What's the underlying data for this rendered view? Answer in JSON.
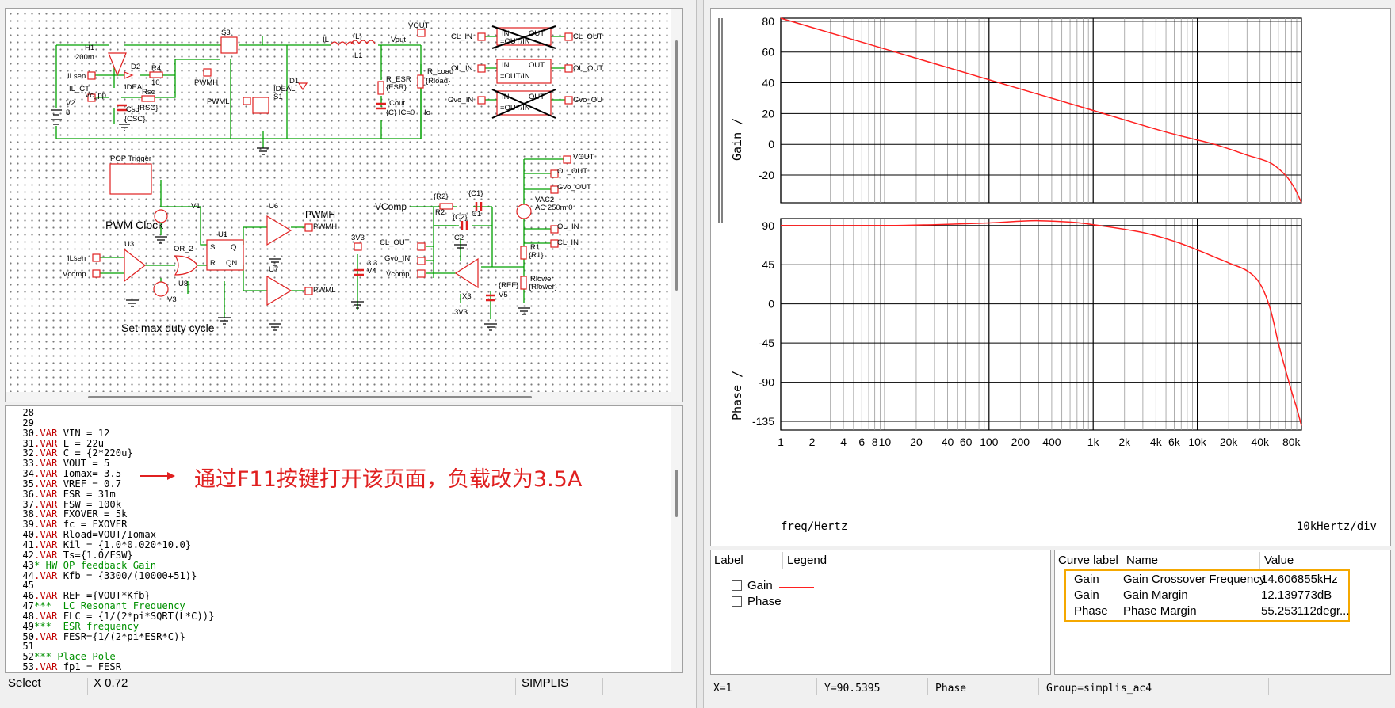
{
  "schematic": {
    "labels": {
      "vout_top": "VOUT",
      "il": "IL",
      "l_val": "{L}",
      "l1": "L1",
      "vout_probe": "Vout",
      "h1": "H1",
      "h1_val": "200m",
      "d2": "D2",
      "d2_val": "IDEAL",
      "r4": "R4",
      "r4_val": "10",
      "ilsen1": "ILsen",
      "il_ct": "IL_CT",
      "vc_pp": "Vc_pp",
      "rsc": "Rsc",
      "rsc_val": "{RSC}",
      "csc": "Csc",
      "csc_val": "{CSC}",
      "v2": "V2",
      "v2_val": "8",
      "s3": "S3",
      "pwmh1": "PWMH",
      "pwml1": "PWML",
      "s1": "S1",
      "d1": "D1",
      "d1_val": "IDEAL",
      "r_esr": "R_ESR",
      "r_esr_val": "{ESR}",
      "cout": "Cout",
      "cout_val": "{C} IC=0",
      "io": "Io",
      "r_load": "R_Load",
      "r_load_val": "{Rload}",
      "cl_in": "CL_IN",
      "cl_out": "CL_OUT",
      "ol_in": "OL_IN",
      "ol_out": "OL_OUT",
      "gvo_in": "Gvo_IN",
      "gvo_out": "Gvo_OU",
      "blk_in": "IN",
      "blk_out": "OUT",
      "blk_eq": "=OUT/IN",
      "pop": "POP Trigger",
      "v1": "V1",
      "pwm_clock": "PWM Clock",
      "u3": "U3",
      "ilsen2": "ILsen",
      "vcomp1": "Vcomp",
      "or2": "OR_2",
      "u8": "U8",
      "v3": "V3",
      "u1": "U1",
      "pin_s": "S",
      "pin_q": "Q",
      "pin_r": "R",
      "pin_qn": "QN",
      "u6": "U6",
      "u7": "U7",
      "pwmh2": "PWMH",
      "pwmh3": "PWMH",
      "pwml2": "PWML",
      "max_duty": "Set max duty cycle",
      "v3v3a": "3V3",
      "v4_val": "3.3",
      "v4": "V4",
      "vcomp2": "VComp",
      "r2_val": "{R2}",
      "r2": "R2",
      "c1_val": "{C1}",
      "c1": "C1",
      "c2_val": "{C2}",
      "c2": "C2",
      "cl_out2": "CL_OUT",
      "gvo_in2": "Gvo_IN",
      "vcomp3": "Vcomp",
      "x3": "X3",
      "v3v3b": "3V3",
      "ref_val": "{REF}",
      "v5": "V5",
      "vout2": "VOUT",
      "ol_out2": "OL_OUT",
      "gvo_out2": "Gvo_OUT",
      "vac2": "VAC2",
      "vac2_val": "AC 250m 0",
      "ol_in2": "OL_IN",
      "cl_in2": "CL_IN",
      "r1": "R1",
      "r1_val": "{R1}",
      "rlower": "Rlower",
      "rlower_val": "{Rlower}"
    }
  },
  "editor": {
    "annotation": "通过F11按键打开该页面，负载改为3.5A",
    "lines": [
      {
        "n": "28",
        "kw": "",
        "text": "",
        "comment": ""
      },
      {
        "n": "29",
        "kw": "",
        "text": "",
        "comment": ""
      },
      {
        "n": "30",
        "kw": ".VAR",
        "text": " VIN = 12",
        "comment": ""
      },
      {
        "n": "31",
        "kw": ".VAR",
        "text": " L = 22u",
        "comment": ""
      },
      {
        "n": "32",
        "kw": ".VAR",
        "text": " C = {2*220u}",
        "comment": ""
      },
      {
        "n": "33",
        "kw": ".VAR",
        "text": " VOUT = 5",
        "comment": ""
      },
      {
        "n": "34",
        "kw": ".VAR",
        "text": " Iomax= 3.5",
        "comment": ""
      },
      {
        "n": "35",
        "kw": ".VAR",
        "text": " VREF = 0.7",
        "comment": ""
      },
      {
        "n": "36",
        "kw": ".VAR",
        "text": " ESR = 31m",
        "comment": ""
      },
      {
        "n": "37",
        "kw": ".VAR",
        "text": " FSW = 100k",
        "comment": ""
      },
      {
        "n": "38",
        "kw": ".VAR",
        "text": " FXOVER = 5k",
        "comment": ""
      },
      {
        "n": "39",
        "kw": ".VAR",
        "text": " fc = FXOVER",
        "comment": ""
      },
      {
        "n": "40",
        "kw": ".VAR",
        "text": " Rload=VOUT/Iomax",
        "comment": ""
      },
      {
        "n": "41",
        "kw": ".VAR",
        "text": " Kil = {1.0*0.020*10.0}",
        "comment": ""
      },
      {
        "n": "42",
        "kw": ".VAR",
        "text": " Ts={1.0/FSW}",
        "comment": ""
      },
      {
        "n": "43",
        "kw": "",
        "text": "",
        "comment": "* HW OP feedback Gain"
      },
      {
        "n": "44",
        "kw": ".VAR",
        "text": " Kfb = {3300/(10000+51)}",
        "comment": ""
      },
      {
        "n": "45",
        "kw": "",
        "text": "",
        "comment": ""
      },
      {
        "n": "46",
        "kw": ".VAR",
        "text": " REF ={VOUT*Kfb}",
        "comment": ""
      },
      {
        "n": "47",
        "kw": "",
        "text": "",
        "comment": "***  LC Resonant Frequency"
      },
      {
        "n": "48",
        "kw": ".VAR",
        "text": " FLC = {1/(2*pi*SQRT(L*C))}",
        "comment": ""
      },
      {
        "n": "49",
        "kw": "",
        "text": "",
        "comment": "***  ESR frequency"
      },
      {
        "n": "50",
        "kw": ".VAR",
        "text": " FESR={1/(2*pi*ESR*C)}",
        "comment": ""
      },
      {
        "n": "51",
        "kw": "",
        "text": "",
        "comment": ""
      },
      {
        "n": "52",
        "kw": "",
        "text": "",
        "comment": "*** Place Pole"
      },
      {
        "n": "53",
        "kw": ".VAR",
        "text": " fp1 = FESR",
        "comment": ""
      }
    ]
  },
  "status_left": {
    "mode": "Select",
    "coord": "X 0.72",
    "app": "SIMPLIS"
  },
  "plot": {
    "gain_ylabel": "Gain /",
    "phase_ylabel": "Phase /",
    "xlabel": "freq/Hertz",
    "xdiv": "10kHertz/div",
    "gain_ticks": [
      "80",
      "60",
      "40",
      "20",
      "0",
      "-20"
    ],
    "phase_ticks": [
      "90",
      "45",
      "0",
      "-45",
      "-90",
      "-135"
    ],
    "x_ticks": [
      "1",
      "2",
      "4",
      "6",
      "8",
      "10",
      "20",
      "40",
      "60",
      "100",
      "200",
      "400",
      "1k",
      "2k",
      "4k",
      "6k",
      "10k",
      "20k",
      "40k",
      "80k"
    ],
    "curve_color": "#ff2020"
  },
  "chart_data": [
    {
      "type": "line",
      "title": "",
      "xlabel": "freq/Hertz",
      "ylabel": "Gain /",
      "x_scale": "log",
      "xlim": [
        1,
        100000
      ],
      "ylim": [
        -38,
        82
      ],
      "series": [
        {
          "name": "Gain",
          "x": [
            1,
            10,
            100,
            1000,
            5000,
            14600,
            30000,
            50000,
            70000,
            85000,
            100000
          ],
          "y": [
            82,
            62,
            42,
            22,
            8,
            0,
            -7,
            -12,
            -20,
            -28,
            -38
          ]
        }
      ]
    },
    {
      "type": "line",
      "title": "",
      "xlabel": "freq/Hertz",
      "ylabel": "Phase /",
      "x_scale": "log",
      "xlim": [
        1,
        100000
      ],
      "ylim": [
        -145,
        98
      ],
      "series": [
        {
          "name": "Phase",
          "x": [
            1,
            10,
            30,
            100,
            200,
            300,
            600,
            1000,
            3000,
            6000,
            10000,
            20000,
            30000,
            40000,
            50000,
            60000,
            70000,
            80000,
            90000,
            100000
          ],
          "y": [
            90,
            90,
            91,
            93,
            95,
            95.5,
            94,
            91,
            82,
            72,
            62,
            47,
            38,
            23,
            -5,
            -45,
            -75,
            -100,
            -120,
            -140
          ]
        }
      ]
    }
  ],
  "legend": {
    "col_label": "Label",
    "col_legend": "Legend",
    "items": [
      {
        "name": "Gain",
        "color": "#ff2020"
      },
      {
        "name": "Phase",
        "color": "#ff2020"
      }
    ]
  },
  "measurements": {
    "col_curve": "Curve label",
    "col_name": "Name",
    "col_value": "Value",
    "highlight_color": "#f5a800",
    "rows": [
      {
        "curve": "Gain",
        "name": "Gain Crossover Frequency",
        "value": "14.606855kHz"
      },
      {
        "curve": "Gain",
        "name": "Gain Margin",
        "value": "12.139773dB"
      },
      {
        "curve": "Phase",
        "name": "Phase Margin",
        "value": "55.253112degr..."
      }
    ]
  },
  "status_right": {
    "x": "X=1",
    "y": "Y=90.5395",
    "curve": "Phase",
    "group": "Group=simplis_ac4"
  }
}
